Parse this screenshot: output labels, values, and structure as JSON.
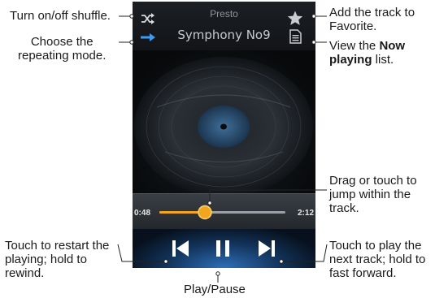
{
  "player": {
    "artist": "Presto",
    "track_title": "Symphony No9",
    "elapsed": "0:48",
    "duration": "2:12",
    "progress": 0.36,
    "colors": {
      "accent": "#f2a51e",
      "control_glow": "#2e6fb8"
    },
    "icons": [
      "shuffle-icon",
      "repeat-icon",
      "star-icon",
      "now-playing-list-icon",
      "previous-icon",
      "pause-icon",
      "next-icon"
    ]
  },
  "callouts": {
    "shuffle": "Turn on/off shuffle.",
    "repeat_line1": "Choose the",
    "repeat_line2": "repeating mode.",
    "favorite_line1": "Add the track to",
    "favorite_line2": "Favorite.",
    "nowplaying_line1_a": "View the ",
    "nowplaying_line1_b": "Now",
    "nowplaying_line2_a": "playing",
    "nowplaying_line2_b": " list.",
    "seek_line1": "Drag or touch to",
    "seek_line2": "jump within the",
    "seek_line3": "track.",
    "prev_line1": "Touch to restart the",
    "prev_line2": "playing; hold to",
    "prev_line3": "rewind.",
    "next_line1": "Touch to play the",
    "next_line2": "next track; hold to",
    "next_line3": "fast forward.",
    "playpause": "Play/Pause"
  }
}
